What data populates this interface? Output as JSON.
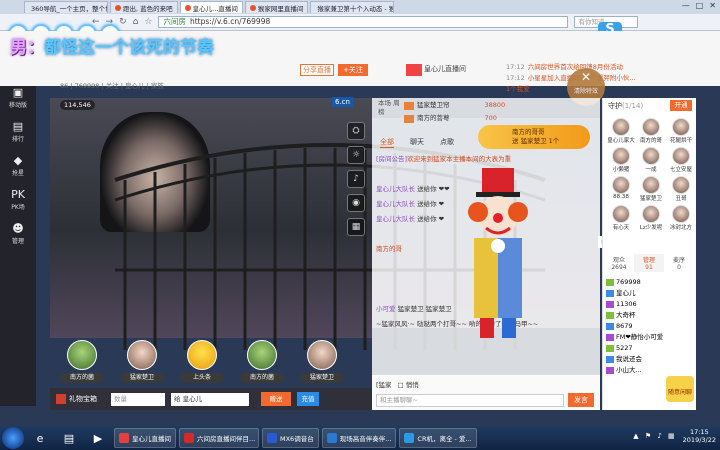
{
  "browser": {
    "tabs": [
      {
        "label": "360导航_一个主页，整个世界",
        "active": false
      },
      {
        "label": "蹬出, 蓝色的来吧",
        "active": false
      },
      {
        "label": "皇心儿...直播间",
        "active": true
      },
      {
        "label": "猴家网里直播间",
        "active": false
      },
      {
        "label": "猴家兼卫第十个入动态 - 猴家网",
        "active": false
      }
    ],
    "nav": {
      "back": "←",
      "forward": "→",
      "refresh": "↻",
      "home": "⌂",
      "star": "☆"
    },
    "security_label": "六间房",
    "url": "https://v.6.cn/769998",
    "search_placeholder": "有你知道",
    "window_controls": [
      "—",
      "□",
      "✕"
    ],
    "pinned_logo": "S"
  },
  "site": {
    "song_prefix": "男：",
    "song_title": "都怪这一个该死的节奏",
    "share_label": "分享直播",
    "follow_label": "+关注",
    "room_meta": "86 | 769998 | 关注 | 皇心儿 | 家族",
    "notice_title": "皇心儿直播间",
    "notices": [
      {
        "time": "17:12",
        "text": "六间房世界首次给回馈8月份活动"
      },
      {
        "time": "17:12",
        "text": "小星星加入直播间，1个雪羿附小伙..."
      },
      {
        "time": "",
        "text": "1个我爱"
      }
    ],
    "close_fx": {
      "x": "✕",
      "label": "清除特效"
    }
  },
  "left_nav": [
    {
      "icon": "▣",
      "label": "移动版"
    },
    {
      "icon": "▤",
      "label": "排行"
    },
    {
      "icon": "◆",
      "label": "抢星"
    },
    {
      "icon": "PK",
      "label": "PK场"
    },
    {
      "icon": "☻",
      "label": "管理"
    }
  ],
  "video": {
    "viewer_count": "114,546",
    "logo": "6.cn",
    "tools": [
      "⛭",
      "☼",
      "♪",
      "◉",
      "▦"
    ],
    "gifts": [
      {
        "name": "南方的菌",
        "style": "tree"
      },
      {
        "name": "猛家楚卫",
        "style": "face"
      },
      {
        "name": "上头条",
        "style": "head"
      },
      {
        "name": "南方的菌",
        "style": "tree"
      },
      {
        "name": "猛家楚卫",
        "style": "face"
      }
    ],
    "bottom": {
      "chest_label": "礼物宝箱",
      "qty_placeholder": "数量",
      "target_value": "给 皇心儿",
      "send_label": "赠送",
      "send2_label": "充值"
    }
  },
  "chat": {
    "side_tabs": "本场 周榜",
    "rank": [
      {
        "name": "猛家楚卫帘",
        "score": "38800"
      },
      {
        "name": "南方的菩萼",
        "score": "700"
      }
    ],
    "tabs": [
      "全部",
      "聊天",
      "点歌"
    ],
    "active_tab": "全部",
    "gift_banner": {
      "line1": "南方的哥哥",
      "line2": "送 猛家楚卫 1个"
    },
    "messages": [
      {
        "who": "[房间公告]",
        "text": "欢迎来到猛家本主播本间的大表为重",
        "sys": true
      },
      {
        "who": "",
        "text": "",
        "sys": false
      },
      {
        "who": "皇心儿大队长",
        "text": " 送给你 ❤❤",
        "sys": false
      },
      {
        "who": "皇心儿大队长",
        "text": " 送给你 ❤",
        "sys": false
      },
      {
        "who": "皇心儿大队长",
        "text": " 送给你 ❤",
        "sys": false
      },
      {
        "who": "",
        "text": "",
        "sys": false
      },
      {
        "who": "",
        "text": "南方的哥",
        "sys": true
      },
      {
        "who": "",
        "text": "",
        "sys": false
      },
      {
        "who": "",
        "text": "",
        "sys": false
      },
      {
        "who": "",
        "text": "",
        "sys": false
      },
      {
        "who": "小可爱",
        "text": " 猛家楚卫 猛家楚卫",
        "sys": false
      },
      {
        "who": "",
        "text": "~猛家风风·~ 哒哒两个打哥~~ 哟的是为了一个马甲~~",
        "sys": false
      }
    ],
    "mode_label": "[猛家",
    "private_label": "□ 悄悄",
    "input_placeholder": "和主播聊聊~",
    "send_label": "发言"
  },
  "right": {
    "guard_title": "守护",
    "guard_count": "(1/14)",
    "open_label": "开通",
    "guards": [
      "皇心儿家大",
      "南方的哥",
      "花腿烘干",
      "小懒猪",
      "一成",
      "七立安屋",
      "88.38",
      "猛家楚卫",
      "丑哥",
      "有心天",
      "Lz少发呢",
      "冰封北方"
    ],
    "stats": [
      {
        "label": "观众",
        "value": "2694"
      },
      {
        "label": "管理",
        "value": "91"
      },
      {
        "label": "麦序",
        "value": "0"
      }
    ],
    "active_stat": "管理",
    "users": [
      {
        "lv": "g",
        "name": "769998"
      },
      {
        "lv": "b",
        "name": "皇心儿"
      },
      {
        "lv": "p",
        "name": "11306"
      },
      {
        "lv": "g",
        "name": "大奇杯"
      },
      {
        "lv": "b",
        "name": "8679"
      },
      {
        "lv": "p",
        "name": "FM❤静怡小可爱"
      },
      {
        "lv": "g",
        "name": "5227"
      },
      {
        "lv": "b",
        "name": "我说还会"
      },
      {
        "lv": "p",
        "name": "小山大..."
      }
    ],
    "feedback_label": "随意闲聊"
  },
  "taskbar": {
    "pinned": [
      "e",
      "▤",
      "▶"
    ],
    "apps": [
      {
        "label": "皇心儿直播间",
        "color": "#e34040"
      },
      {
        "label": "六间房直播间伴目...",
        "color": "#d02a2a"
      },
      {
        "label": "MX6调音台",
        "color": "#2a5ad2"
      },
      {
        "label": "现场高音伴奏伴...",
        "color": "#2a7ad2"
      },
      {
        "label": "CR机，离全 - 爱...",
        "color": "#2a9ae8"
      }
    ],
    "tray_icons": "▲ ⚑ ♪ ▦",
    "time": "17:15",
    "date": "2019/3/22"
  }
}
